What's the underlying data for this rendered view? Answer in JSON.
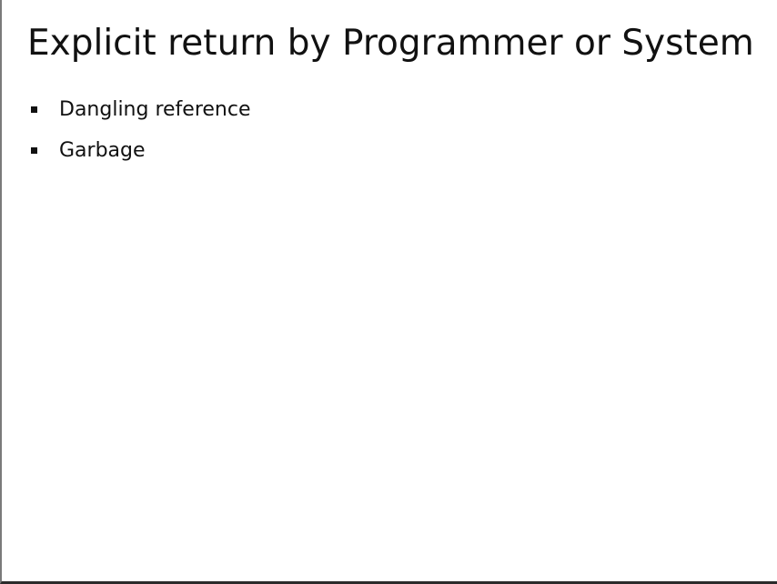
{
  "slide": {
    "title": "Explicit return by Programmer or System",
    "bullets": [
      {
        "text": "Dangling reference"
      },
      {
        "text": "Garbage"
      }
    ]
  }
}
